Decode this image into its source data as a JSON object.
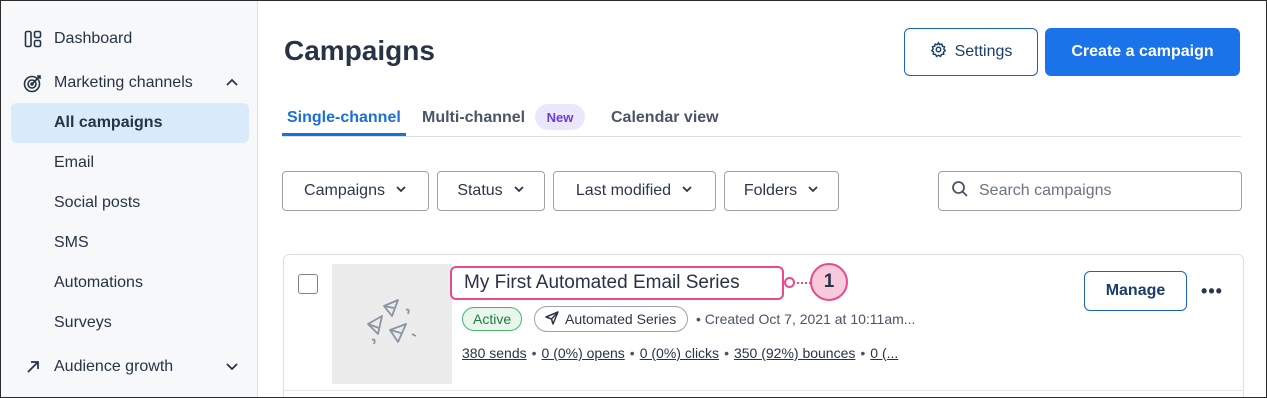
{
  "sidebar": {
    "items": [
      {
        "label": "Dashboard",
        "icon": "dashboard-icon"
      },
      {
        "label": "Marketing channels",
        "icon": "target-icon",
        "expanded": true
      },
      {
        "label": "All campaigns",
        "active": true
      },
      {
        "label": "Email"
      },
      {
        "label": "Social posts"
      },
      {
        "label": "SMS"
      },
      {
        "label": "Automations"
      },
      {
        "label": "Surveys"
      },
      {
        "label": "Audience growth",
        "icon": "arrow-up-right-icon",
        "expanded": false
      }
    ]
  },
  "header": {
    "title": "Campaigns",
    "settings_label": "Settings",
    "create_label": "Create a campaign"
  },
  "tabs": [
    {
      "label": "Single-channel",
      "active": true
    },
    {
      "label": "Multi-channel",
      "badge": "New"
    },
    {
      "label": "Calendar view"
    }
  ],
  "filters": [
    {
      "label": "Campaigns"
    },
    {
      "label": "Status"
    },
    {
      "label": "Last modified"
    },
    {
      "label": "Folders"
    }
  ],
  "search": {
    "placeholder": "Search campaigns"
  },
  "campaign": {
    "title": "My First Automated Email Series",
    "callout_number": "1",
    "status": "Active",
    "type": "Automated Series",
    "created": "• Created Oct 7, 2021 at 10:11am...",
    "stats": {
      "sends": "380 sends",
      "opens": "0 (0%) opens",
      "clicks": "0 (0%) clicks",
      "bounces": "350 (92%) bounces",
      "more": "0 (..."
    },
    "manage_label": "Manage",
    "more_label": "•••"
  },
  "colors": {
    "primary": "#1a73e8",
    "active_nav": "#d9eafa",
    "highlight": "#e84a8b",
    "badge_new_bg": "#ece6fb",
    "status_active": "#1e7c3e"
  }
}
